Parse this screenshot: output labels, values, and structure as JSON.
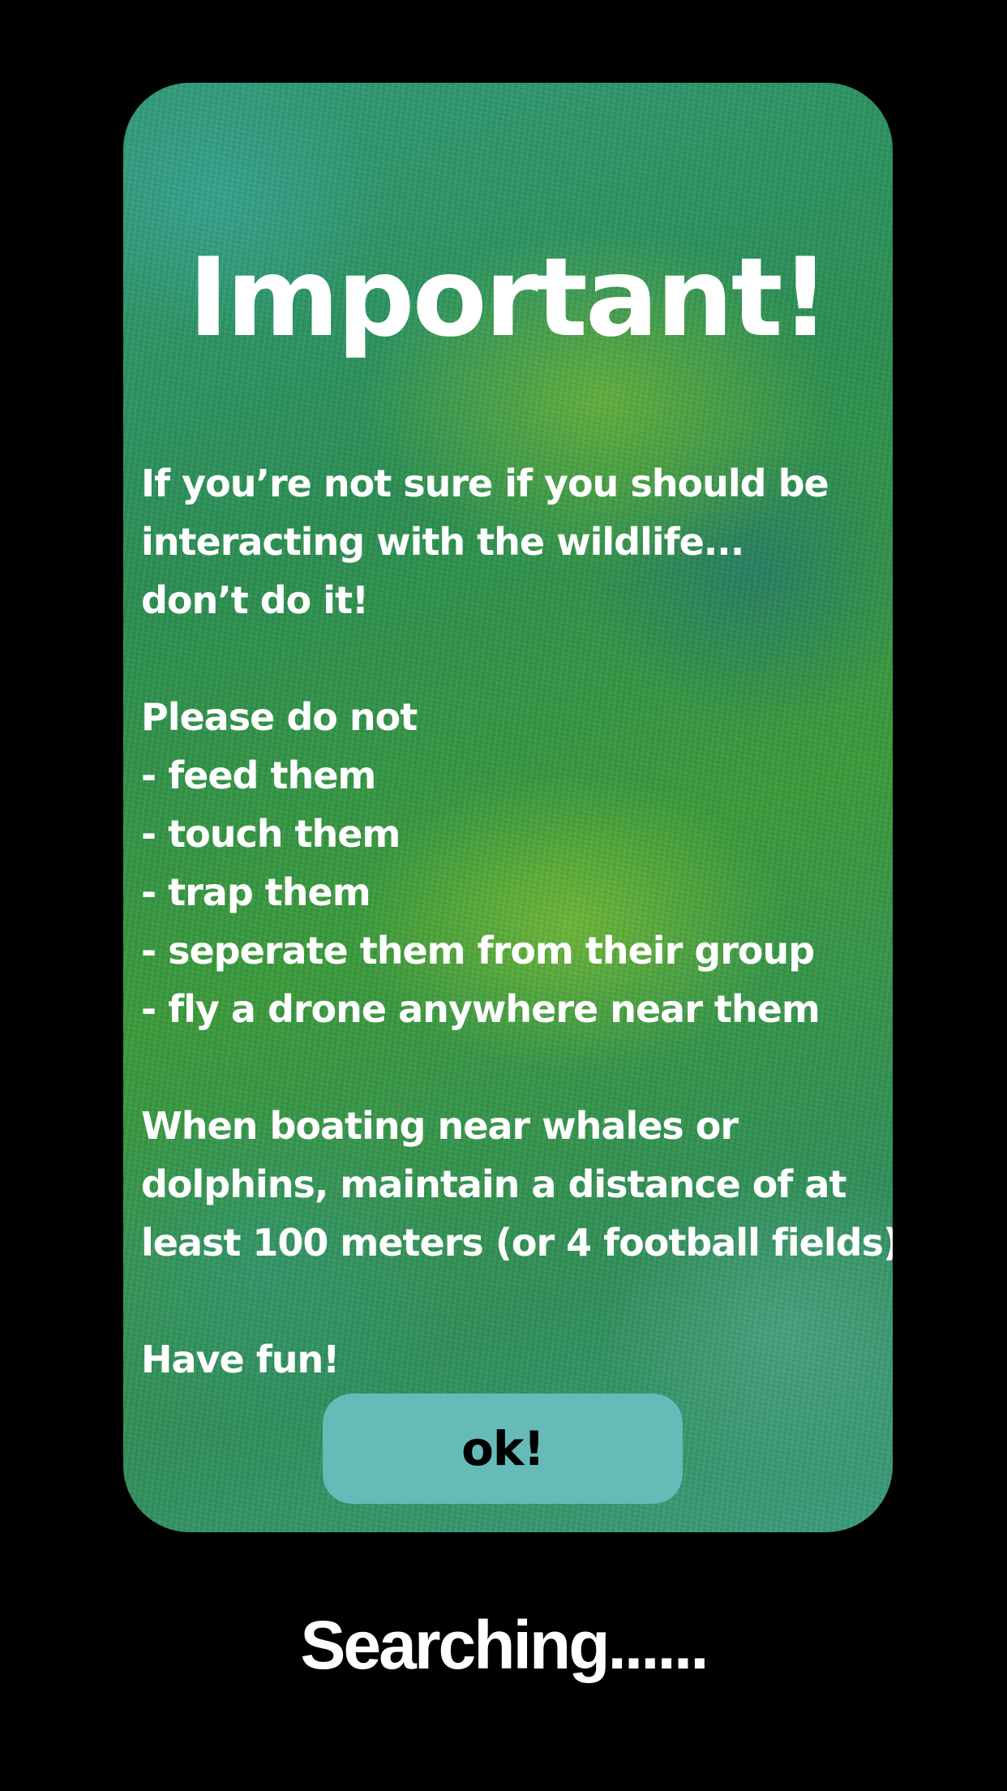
{
  "dialog": {
    "title": "Important!",
    "paragraph1": {
      "line1": "If you’re not sure if you should be",
      "line2": "interacting with the wildlife...",
      "line3": "don’t do it!"
    },
    "donts": {
      "heading": "Please do not",
      "items": [
        "- feed them",
        "- touch them",
        "- trap them",
        "- seperate them from their group",
        "- fly a drone anywhere near them"
      ]
    },
    "paragraph2": {
      "line1": "When boating near whales or",
      "line2": "dolphins, maintain a distance of at",
      "line3": "least 100 meters (or 4 football fields)"
    },
    "closing": "Have fun!",
    "ok_label": "ok!"
  },
  "status_text": "Searching......",
  "colors": {
    "background": "#000000",
    "card_green": "#2f8f5a",
    "button": "#66bbb8",
    "text": "#ffffff",
    "button_text": "#000000"
  }
}
